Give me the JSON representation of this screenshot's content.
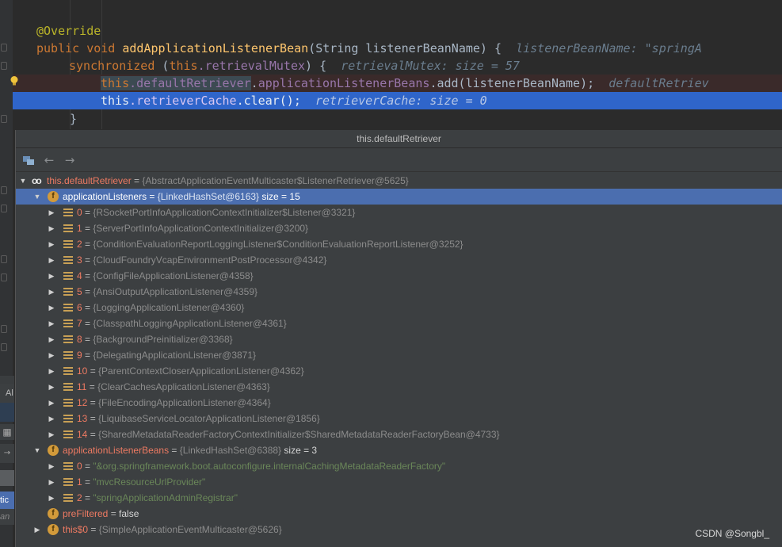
{
  "editor": {
    "line1_annotation": "@Override",
    "line2": {
      "kw1": "public",
      "kw2": "void",
      "method": "addApplicationListenerBean",
      "params": "(String listenerBeanName)",
      "brace": "{",
      "hint": "listenerBeanName: \"springA"
    },
    "line3": {
      "kw": "synchronized",
      "open": "(",
      "this_kw": "this",
      "field": ".retrievalMutex",
      "close": ")",
      "brace": "{",
      "hint": "retrievalMutex:  size = 57"
    },
    "line4": {
      "this_kw": "this",
      "field": ".defaultRetriever",
      "rest1": ".",
      "field2": "applicationListenerBeans",
      "rest2": ".add(listenerBeanName);",
      "hint": "defaultRetriev"
    },
    "line5": {
      "this_kw": "this",
      "field": ".retrieverCache",
      "rest": ".clear();",
      "hint": "retrieverCache:  size = 0"
    },
    "line6_brace": "}"
  },
  "popup": {
    "title": "this.defaultRetriever",
    "toolbar": {
      "pin_icon": "tree-view-icon",
      "back_icon": "←",
      "forward_icon": "→"
    },
    "root": {
      "name": "this.defaultRetriever",
      "eq": " = ",
      "value": "{AbstractApplicationEventMulticaster$ListenerRetriever@5625}"
    },
    "applicationListeners": {
      "name": "applicationListeners",
      "eq": " = ",
      "value": "{LinkedHashSet@6163}",
      "size": "  size = 15",
      "items": [
        {
          "index": "0",
          "value": "{RSocketPortInfoApplicationContextInitializer$Listener@3321}"
        },
        {
          "index": "1",
          "value": "{ServerPortInfoApplicationContextInitializer@3200}"
        },
        {
          "index": "2",
          "value": "{ConditionEvaluationReportLoggingListener$ConditionEvaluationReportListener@3252}"
        },
        {
          "index": "3",
          "value": "{CloudFoundryVcapEnvironmentPostProcessor@4342}"
        },
        {
          "index": "4",
          "value": "{ConfigFileApplicationListener@4358}"
        },
        {
          "index": "5",
          "value": "{AnsiOutputApplicationListener@4359}"
        },
        {
          "index": "6",
          "value": "{LoggingApplicationListener@4360}"
        },
        {
          "index": "7",
          "value": "{ClasspathLoggingApplicationListener@4361}"
        },
        {
          "index": "8",
          "value": "{BackgroundPreinitializer@3368}"
        },
        {
          "index": "9",
          "value": "{DelegatingApplicationListener@3871}"
        },
        {
          "index": "10",
          "value": "{ParentContextCloserApplicationListener@4362}"
        },
        {
          "index": "11",
          "value": "{ClearCachesApplicationListener@4363}"
        },
        {
          "index": "12",
          "value": "{FileEncodingApplicationListener@4364}"
        },
        {
          "index": "13",
          "value": "{LiquibaseServiceLocatorApplicationListener@1856}"
        },
        {
          "index": "14",
          "value": "{SharedMetadataReaderFactoryContextInitializer$SharedMetadataReaderFactoryBean@4733}"
        }
      ]
    },
    "applicationListenerBeans": {
      "name": "applicationListenerBeans",
      "eq": " = ",
      "value": "{LinkedHashSet@6388}",
      "size": "  size = 3",
      "items": [
        {
          "index": "0",
          "value": "\"&org.springframework.boot.autoconfigure.internalCachingMetadataReaderFactory\""
        },
        {
          "index": "1",
          "value": "\"mvcResourceUrlProvider\""
        },
        {
          "index": "2",
          "value": "\"springApplicationAdminRegistrar\""
        }
      ]
    },
    "preFiltered": {
      "name": "preFiltered",
      "eq": " = ",
      "value": "false"
    },
    "this0": {
      "name": "this$0",
      "eq": " = ",
      "value": "{SimpleApplicationEventMulticaster@5626}"
    }
  },
  "left_slivers": {
    "tab_label": "Al",
    "sel_text": "tic",
    "dim_text": "an"
  },
  "watermark": "CSDN @Songbl_",
  "colors": {
    "editor_bg": "#2b2b2b",
    "popup_bg": "#3c3f41",
    "selection": "#4b6eaf",
    "current_line": "#2f65ca",
    "field_name": "#ee7a62",
    "keyword": "#cc7832",
    "string": "#6a8759"
  }
}
